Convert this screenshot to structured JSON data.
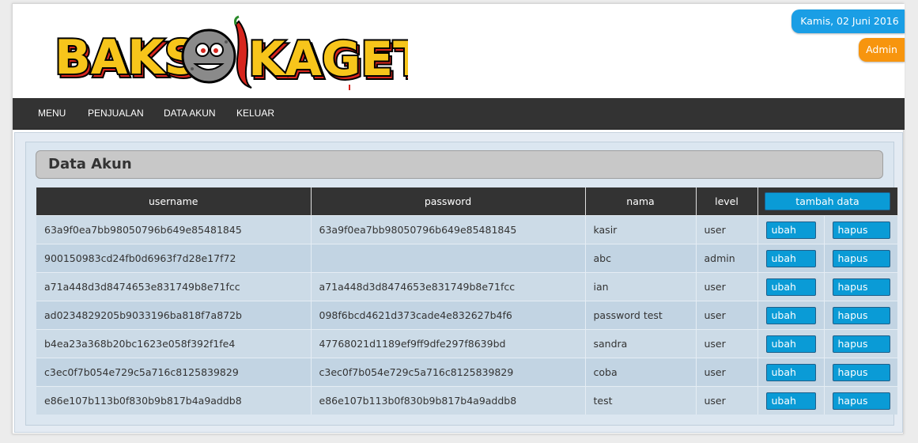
{
  "header": {
    "logo_text": "BAKSO KAGET",
    "date": "Kamis, 02 Juni 2016",
    "user": "Admin"
  },
  "nav": [
    "MENU",
    "PENJUALAN",
    "DATA AKUN",
    "KELUAR"
  ],
  "panel": {
    "title": "Data Akun"
  },
  "table": {
    "headers": [
      "username",
      "password",
      "nama",
      "level"
    ],
    "add_label": "tambah data",
    "edit_label": "ubah",
    "delete_label": "hapus",
    "rows": [
      {
        "username": "63a9f0ea7bb98050796b649e85481845",
        "password": "63a9f0ea7bb98050796b649e85481845",
        "nama": "kasir",
        "level": "user"
      },
      {
        "username": "900150983cd24fb0d6963f7d28e17f72",
        "password": "",
        "nama": "abc",
        "level": "admin"
      },
      {
        "username": "a71a448d3d8474653e831749b8e71fcc",
        "password": "a71a448d3d8474653e831749b8e71fcc",
        "nama": "ian",
        "level": "user"
      },
      {
        "username": "ad0234829205b9033196ba818f7a872b",
        "password": "098f6bcd4621d373cade4e832627b4f6",
        "nama": "password test",
        "level": "user"
      },
      {
        "username": "b4ea23a368b20bc1623e058f392f1fe4",
        "password": "47768021d1189ef9ff9dfe297f8639bd",
        "nama": "sandra",
        "level": "user"
      },
      {
        "username": "c3ec0f7b054e729c5a716c8125839829",
        "password": "c3ec0f7b054e729c5a716c8125839829",
        "nama": "coba",
        "level": "user"
      },
      {
        "username": "e86e107b113b0f830b9b817b4a9addb8",
        "password": "e86e107b113b0f830b9b817b4a9addb8",
        "nama": "test",
        "level": "user"
      }
    ]
  },
  "colors": {
    "nav_bg": "#333333",
    "date_badge": "#1a9ee5",
    "admin_badge": "#f7950e",
    "button": "#0a9bd6",
    "logo_red": "#d7261e",
    "logo_yellow": "#f7c51b"
  }
}
